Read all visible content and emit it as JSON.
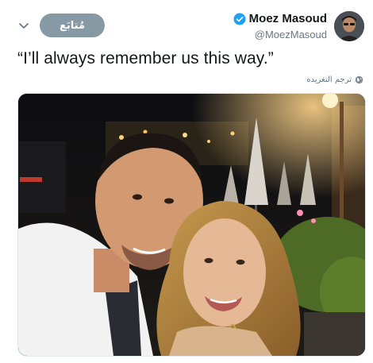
{
  "header": {
    "display_name": "Moez Masoud",
    "handle": "@MoezMasoud",
    "follow_label": "مُتابَع",
    "verified": true
  },
  "tweet": {
    "text": "“I’ll always remember us this way.”",
    "translate_label": "ترجم التغريدة"
  },
  "icons": {
    "menu": "chevron-down-icon",
    "verified": "verified-badge-icon",
    "translate": "globe-icon"
  },
  "colors": {
    "verified": "#1da1f2",
    "follow_button": "#8899a6",
    "secondary_text": "#657786"
  }
}
